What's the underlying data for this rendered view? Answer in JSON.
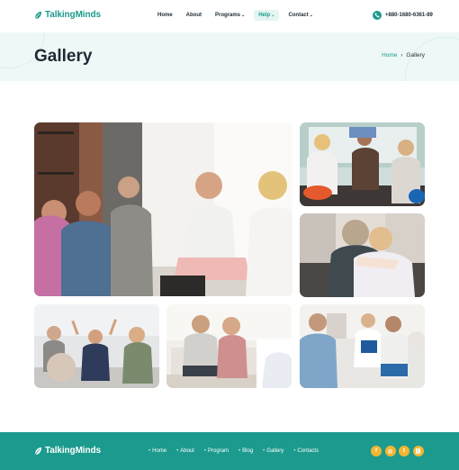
{
  "header": {
    "logo_text": "TalkingMinds",
    "nav": [
      {
        "label": "Home",
        "active": false,
        "dropdown": false
      },
      {
        "label": "About",
        "active": false,
        "dropdown": false
      },
      {
        "label": "Programs",
        "active": false,
        "dropdown": true
      },
      {
        "label": "Help",
        "active": true,
        "dropdown": true
      },
      {
        "label": "Contact",
        "active": false,
        "dropdown": true
      }
    ],
    "phone": "+880-1680-6361-89"
  },
  "banner": {
    "title": "Gallery",
    "breadcrumb_home": "Home",
    "breadcrumb_separator": "›",
    "breadcrumb_current": "Gallery"
  },
  "gallery": {
    "photos": [
      {
        "name": "group-therapy-circle",
        "icon": "photo"
      },
      {
        "name": "group-high-five",
        "icon": "photo"
      },
      {
        "name": "emotional-hug",
        "icon": "photo"
      },
      {
        "name": "raised-hands-group",
        "icon": "photo"
      },
      {
        "name": "couple-counseling",
        "icon": "photo"
      },
      {
        "name": "group-session-notes",
        "icon": "photo"
      }
    ]
  },
  "footer": {
    "logo_text": "TalkingMinds",
    "nav": [
      "Home",
      "About",
      "Program",
      "Blog",
      "Gallery",
      "Contacts"
    ],
    "social": [
      {
        "icon": "facebook-icon",
        "glyph": "f"
      },
      {
        "icon": "instagram-icon",
        "glyph": "◎"
      },
      {
        "icon": "twitter-icon",
        "glyph": "t"
      },
      {
        "icon": "link-icon",
        "glyph": "⛓"
      }
    ]
  },
  "colors": {
    "brand": "#1c9a8e",
    "banner_bg": "#eef8f6",
    "social": "#f2b632"
  }
}
